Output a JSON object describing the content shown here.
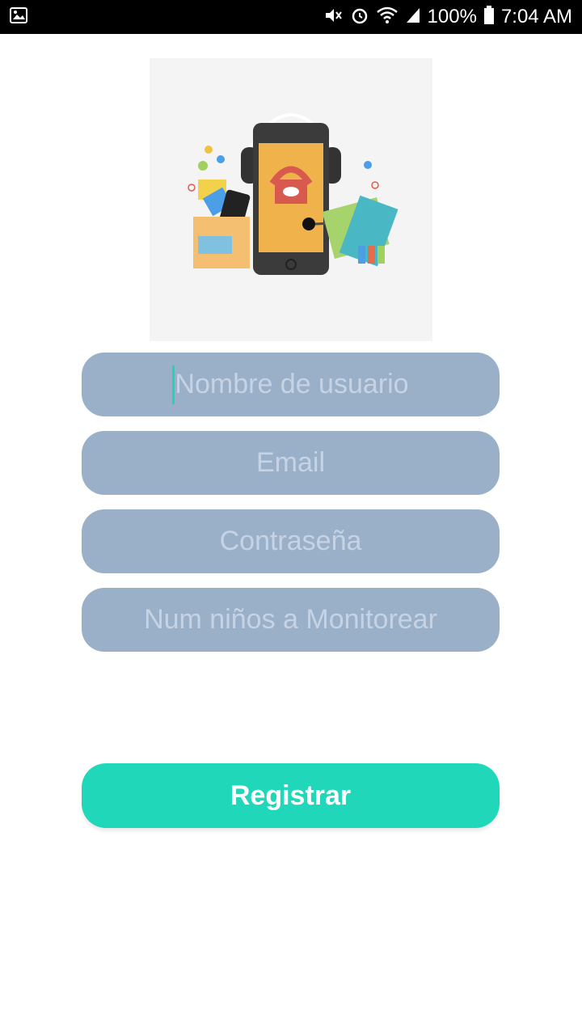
{
  "status_bar": {
    "battery": "100%",
    "time": "7:04 AM",
    "icons": [
      "image-icon",
      "mute-icon",
      "alarm-icon",
      "wifi-icon",
      "signal-icon",
      "battery-icon"
    ]
  },
  "form": {
    "username_placeholder": "Nombre de usuario",
    "email_placeholder": "Email",
    "password_placeholder": "Contraseña",
    "children_placeholder": "Num niños a Monitorear"
  },
  "actions": {
    "register_label": "Registrar"
  },
  "colors": {
    "field_bg": "#9ab0c8",
    "field_text": "#c6d3e4",
    "accent": "#20d8b9"
  }
}
